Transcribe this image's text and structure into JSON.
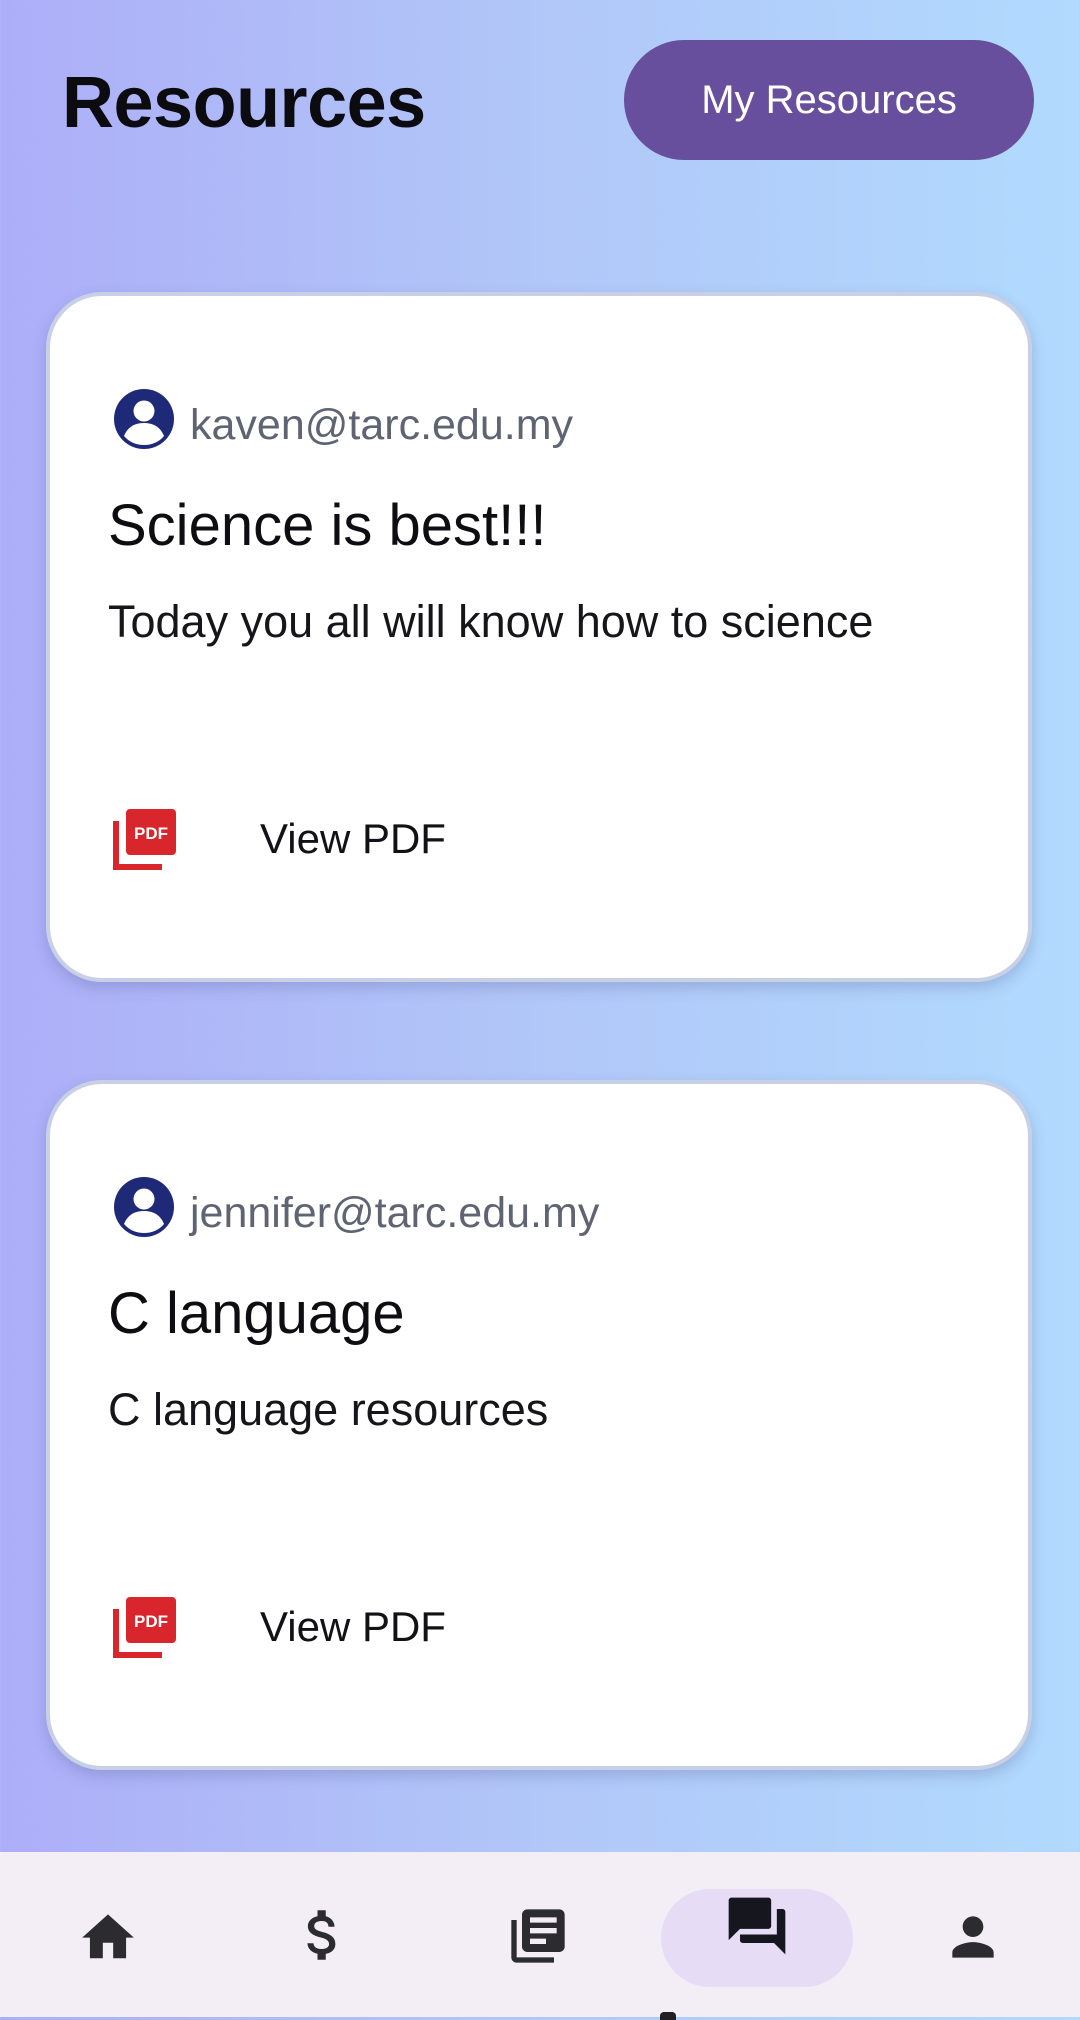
{
  "header": {
    "title": "Resources",
    "my_resources_label": "My Resources"
  },
  "resources": [
    {
      "author_email": "kaven@tarc.edu.my",
      "title": "Science is best!!!",
      "description": "Today you all will know how to science",
      "pdf_label": "View PDF",
      "pdf_icon": "pdf-file-icon"
    },
    {
      "author_email": "jennifer@tarc.edu.my",
      "title": "C language",
      "description": "C language resources",
      "pdf_label": "View PDF",
      "pdf_icon": "pdf-file-icon"
    }
  ],
  "bottom_nav": {
    "items": [
      {
        "icon": "home-icon"
      },
      {
        "icon": "dollar-icon"
      },
      {
        "icon": "library-icon"
      },
      {
        "icon": "forum-icon",
        "active": true
      },
      {
        "icon": "person-icon"
      }
    ]
  },
  "colors": {
    "accent": "#674f9e",
    "avatar": "#1e2a78",
    "pdf_red": "#d9262c",
    "nav_active_bg": "#e6dcf5"
  }
}
